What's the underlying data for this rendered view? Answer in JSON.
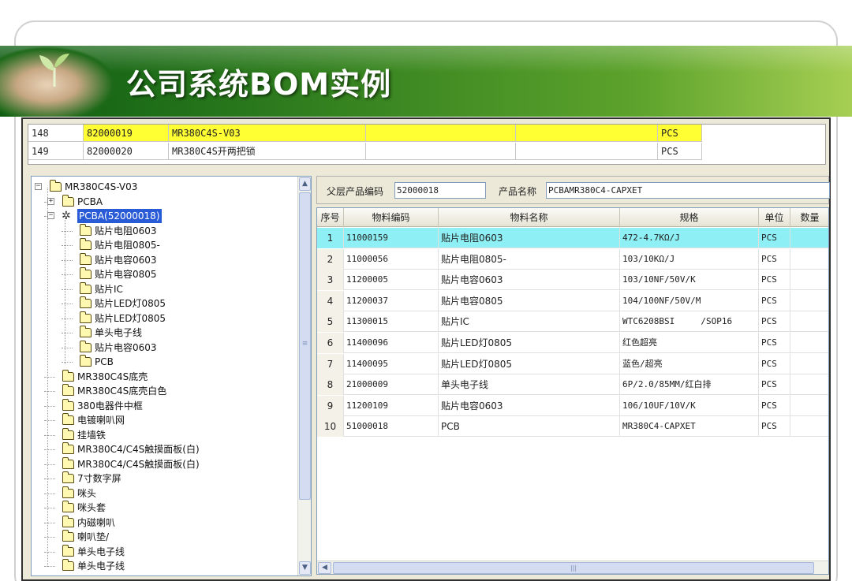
{
  "slide": {
    "title": "公司系统BOM实例"
  },
  "top_grid": {
    "rows": [
      {
        "seq": "148",
        "code": "82000019",
        "name": "MR380C4S-V03",
        "unit": "PCS",
        "highlight": true
      },
      {
        "seq": "149",
        "code": "82000020",
        "name": "MR380C4S开两把锁",
        "unit": "PCS",
        "highlight": false
      }
    ]
  },
  "tree": {
    "nodes": [
      {
        "label": "MR380C4S-V03",
        "level": 0,
        "expander": "−",
        "icon": "folder-icon"
      },
      {
        "label": "PCBA",
        "level": 1,
        "expander": "+",
        "icon": "folder-icon"
      },
      {
        "label": "PCBA(52000018)",
        "level": 1,
        "expander": "−",
        "icon": "gear-icon",
        "selected": true
      },
      {
        "label": "贴片电阻0603",
        "level": 2,
        "icon": "folder-icon"
      },
      {
        "label": "贴片电阻0805-",
        "level": 2,
        "icon": "folder-icon"
      },
      {
        "label": "贴片电容0603",
        "level": 2,
        "icon": "folder-icon"
      },
      {
        "label": "贴片电容0805",
        "level": 2,
        "icon": "folder-icon"
      },
      {
        "label": "贴片IC",
        "level": 2,
        "icon": "folder-icon"
      },
      {
        "label": "贴片LED灯0805",
        "level": 2,
        "icon": "folder-icon"
      },
      {
        "label": "贴片LED灯0805",
        "level": 2,
        "icon": "folder-icon"
      },
      {
        "label": "单头电子线",
        "level": 2,
        "icon": "folder-icon"
      },
      {
        "label": "贴片电容0603",
        "level": 2,
        "icon": "folder-icon"
      },
      {
        "label": "PCB",
        "level": 2,
        "icon": "folder-icon"
      },
      {
        "label": "MR380C4S底壳",
        "level": 1,
        "icon": "folder-icon"
      },
      {
        "label": "MR380C4S底壳白色",
        "level": 1,
        "icon": "folder-icon"
      },
      {
        "label": "380电器件中框",
        "level": 1,
        "icon": "folder-icon"
      },
      {
        "label": "电镀喇叭网",
        "level": 1,
        "icon": "folder-icon"
      },
      {
        "label": "挂墙铁",
        "level": 1,
        "icon": "folder-icon"
      },
      {
        "label": "MR380C4/C4S触摸面板(白)",
        "level": 1,
        "icon": "folder-icon"
      },
      {
        "label": "MR380C4/C4S触摸面板(白)",
        "level": 1,
        "icon": "folder-icon"
      },
      {
        "label": "7寸数字屏",
        "level": 1,
        "icon": "folder-icon"
      },
      {
        "label": "咪头",
        "level": 1,
        "icon": "folder-icon"
      },
      {
        "label": "咪头套",
        "level": 1,
        "icon": "folder-icon"
      },
      {
        "label": "内磁喇叭",
        "level": 1,
        "icon": "folder-icon"
      },
      {
        "label": "喇叭垫/",
        "level": 1,
        "icon": "folder-icon"
      },
      {
        "label": "单头电子线",
        "level": 1,
        "icon": "folder-icon"
      },
      {
        "label": "单头电子线",
        "level": 1,
        "icon": "folder-icon"
      }
    ]
  },
  "detail": {
    "parent_code_label": "父层产品编码",
    "parent_code_value": "52000018",
    "product_name_label": "产品名称",
    "product_name_value": "PCBAMR380C4-CAPXET",
    "columns": [
      "序号",
      "物料编码",
      "物料名称",
      "规格",
      "单位",
      "数量"
    ],
    "rows": [
      {
        "no": "1",
        "code": "11000159",
        "name": "贴片电阻0603",
        "spec": "472-4.7KΩ/J",
        "unit": "PCS",
        "selected": true
      },
      {
        "no": "2",
        "code": "11000056",
        "name": "贴片电阻0805-",
        "spec": "103/10KΩ/J",
        "unit": "PCS"
      },
      {
        "no": "3",
        "code": "11200005",
        "name": "贴片电容0603",
        "spec": "103/10NF/50V/K",
        "unit": "PCS"
      },
      {
        "no": "4",
        "code": "11200037",
        "name": "贴片电容0805",
        "spec": "104/100NF/50V/M",
        "unit": "PCS"
      },
      {
        "no": "5",
        "code": "11300015",
        "name": "贴片IC",
        "spec": "WTC6208BSI     /SOP16",
        "unit": "PCS"
      },
      {
        "no": "6",
        "code": "11400096",
        "name": "贴片LED灯0805",
        "spec": "红色超亮",
        "unit": "PCS"
      },
      {
        "no": "7",
        "code": "11400095",
        "name": "贴片LED灯0805",
        "spec": "蓝色/超亮",
        "unit": "PCS"
      },
      {
        "no": "8",
        "code": "21000009",
        "name": "单头电子线",
        "spec": "6P/2.0/85MM/红白排",
        "unit": "PCS"
      },
      {
        "no": "9",
        "code": "11200109",
        "name": "贴片电容0603",
        "spec": "106/10UF/10V/K",
        "unit": "PCS"
      },
      {
        "no": "10",
        "code": "51000018",
        "name": "PCB",
        "spec": "MR380C4-CAPXET",
        "unit": "PCS"
      }
    ]
  },
  "scroll": {
    "up": "▲",
    "down": "▼",
    "left": "◀",
    "grip": "|||",
    "mid": "≡"
  }
}
